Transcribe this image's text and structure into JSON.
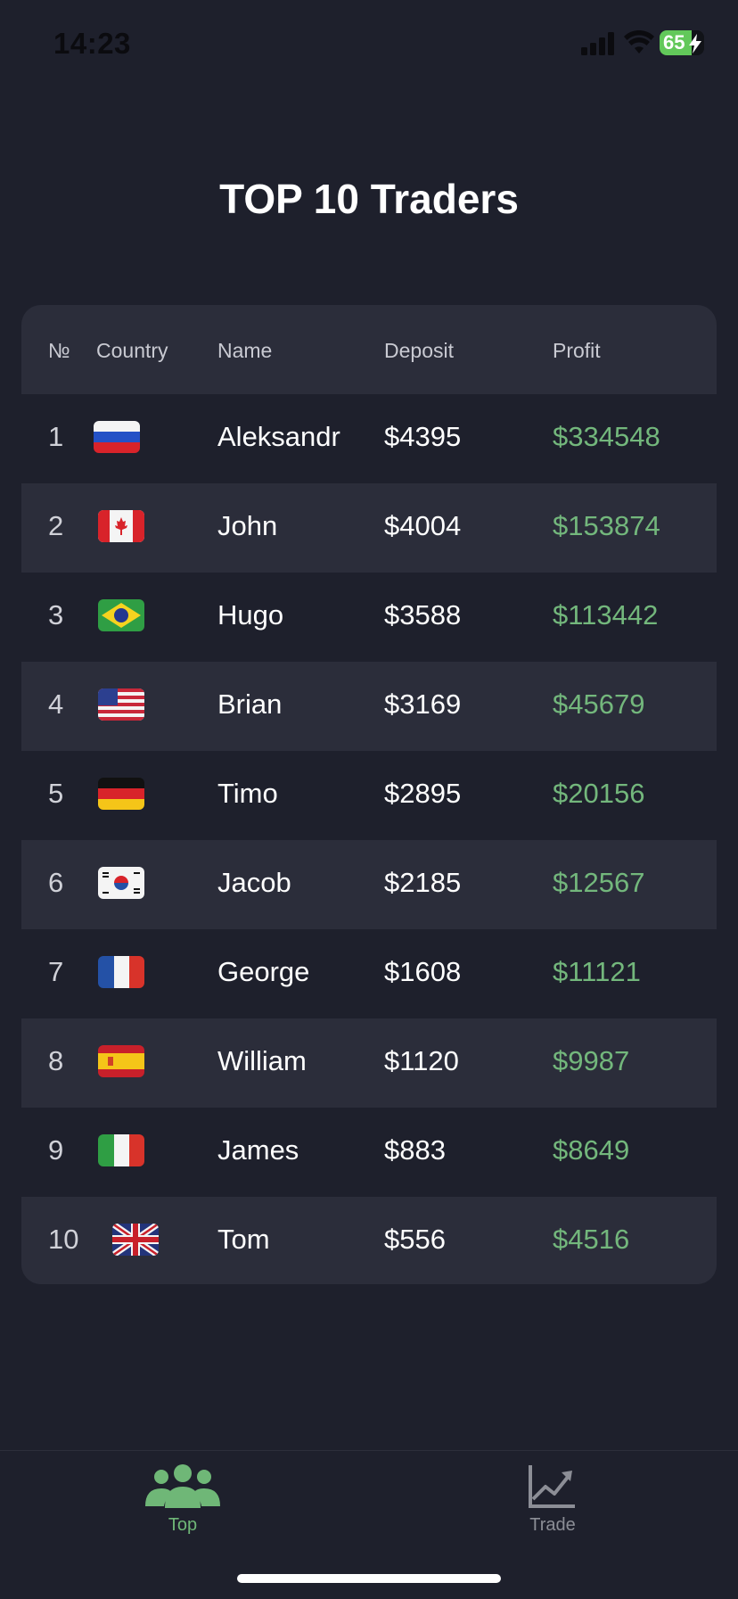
{
  "status_bar": {
    "time": "14:23",
    "battery": "65"
  },
  "title": "TOP 10 Traders",
  "table": {
    "headers": {
      "rank": "№",
      "country": "Country",
      "name": "Name",
      "deposit": "Deposit",
      "profit": "Profit"
    },
    "rows": [
      {
        "rank": "1",
        "flag": "russia-flag",
        "name": "Aleksandr",
        "deposit": "$4395",
        "profit": "$334548"
      },
      {
        "rank": "2",
        "flag": "canada-flag",
        "name": "John",
        "deposit": "$4004",
        "profit": "$153874"
      },
      {
        "rank": "3",
        "flag": "brazil-flag",
        "name": "Hugo",
        "deposit": "$3588",
        "profit": "$113442"
      },
      {
        "rank": "4",
        "flag": "usa-flag",
        "name": "Brian",
        "deposit": "$3169",
        "profit": "$45679"
      },
      {
        "rank": "5",
        "flag": "germany-flag",
        "name": "Timo",
        "deposit": "$2895",
        "profit": "$20156"
      },
      {
        "rank": "6",
        "flag": "south-korea-flag",
        "name": "Jacob",
        "deposit": "$2185",
        "profit": "$12567"
      },
      {
        "rank": "7",
        "flag": "france-flag",
        "name": "George",
        "deposit": "$1608",
        "profit": "$11121"
      },
      {
        "rank": "8",
        "flag": "spain-flag",
        "name": "William",
        "deposit": "$1120",
        "profit": "$9987"
      },
      {
        "rank": "9",
        "flag": "italy-flag",
        "name": "James",
        "deposit": "$883",
        "profit": "$8649"
      },
      {
        "rank": "10",
        "flag": "uk-flag",
        "name": "Tom",
        "deposit": "$556",
        "profit": "$4516"
      }
    ]
  },
  "tabs": [
    {
      "label": "Top",
      "icon": "people-group-icon",
      "active": true
    },
    {
      "label": "Trade",
      "icon": "trend-chart-icon",
      "active": false
    }
  ],
  "colors": {
    "background": "#1e202c",
    "row_alt": "#2b2d3a",
    "profit": "#73b77c",
    "accent": "#6fb777"
  }
}
